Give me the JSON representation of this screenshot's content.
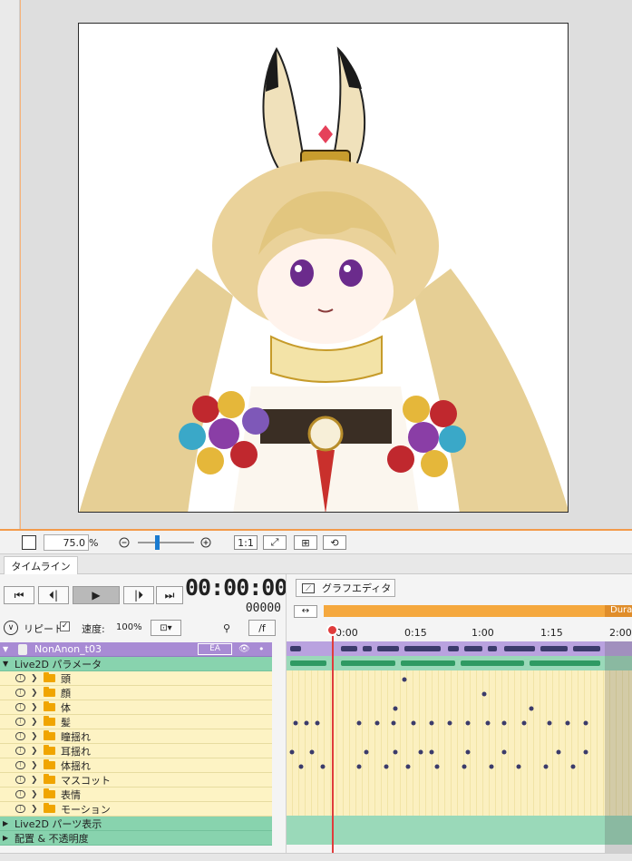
{
  "viewport": {
    "zoom_value": "75.0",
    "zoom_unit": "%",
    "buttons": {
      "actual_size": "1:1"
    }
  },
  "timeline": {
    "tab_label": "タイムライン",
    "current_time": "00:00:00",
    "current_frame": "00000",
    "repeat_label": "リピート",
    "repeat_checked": true,
    "speed_label": "速度:",
    "speed_value": "100%",
    "frame_unit_button": "/f",
    "graph_editor_label": "グラフエディタ",
    "duration_label": "Dura",
    "ruler_ticks": [
      "0:00",
      "0:15",
      "1:00",
      "1:15",
      "2:00"
    ],
    "model": {
      "name": "NonAnon_t03",
      "badge": "EA"
    },
    "groups": {
      "params": "Live2D パラメータ",
      "parts": "Live2D パーツ表示",
      "layout": "配置 & 不透明度"
    },
    "params": [
      "頭",
      "顔",
      "体",
      "髪",
      "瞳揺れ",
      "耳揺れ",
      "体揺れ",
      "マスコット",
      "表情",
      "モーション"
    ]
  },
  "colors": {
    "accent_orange": "#f39a4a",
    "range_orange": "#f5a83e",
    "model_purple": "#a88bd4",
    "group_green": "#88d3ae",
    "param_yellow": "#fdf3c4",
    "playhead_red": "#e03c3c",
    "slider_blue": "#1a7bd0"
  },
  "icons": [
    "zoom-out-icon",
    "zoom-in-icon",
    "fit-icon",
    "grid-icon",
    "reset-view-icon",
    "skip-start-icon",
    "step-back-icon",
    "play-icon",
    "step-forward-icon",
    "skip-end-icon",
    "eye-icon",
    "pin-icon",
    "folder-icon",
    "chevron-right-icon",
    "collapse-icon"
  ]
}
